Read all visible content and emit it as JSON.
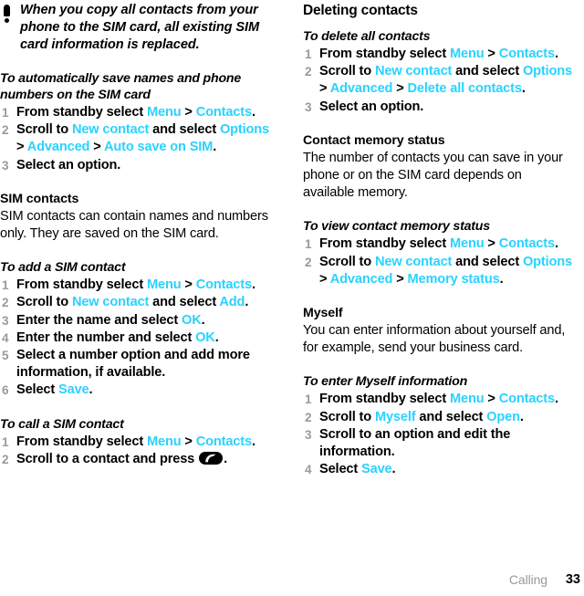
{
  "accent_color": "#2ad2ff",
  "muted_color": "#9a9a9a",
  "note": {
    "icon": "exclamation-note-icon",
    "text": "When you copy all contacts from your phone to the SIM card, all existing SIM card information is replaced."
  },
  "left_column": {
    "proc_autosave": {
      "heading": "To automatically save names and phone numbers on the SIM card",
      "steps": [
        {
          "num": "1",
          "parts": [
            {
              "t": "From standby select ",
              "k": "plain"
            },
            {
              "t": "Menu",
              "k": "ui"
            },
            {
              "t": " > ",
              "k": "sep"
            },
            {
              "t": "Contacts",
              "k": "ui"
            },
            {
              "t": ".",
              "k": "plain"
            }
          ]
        },
        {
          "num": "2",
          "parts": [
            {
              "t": "Scroll to ",
              "k": "plain"
            },
            {
              "t": "New contact",
              "k": "ui"
            },
            {
              "t": " and select ",
              "k": "plain"
            },
            {
              "t": "Options",
              "k": "ui"
            },
            {
              "t": " > ",
              "k": "sep"
            },
            {
              "t": "Advanced",
              "k": "ui"
            },
            {
              "t": " > ",
              "k": "sep"
            },
            {
              "t": "Auto save on SIM",
              "k": "ui"
            },
            {
              "t": ".",
              "k": "plain"
            }
          ]
        },
        {
          "num": "3",
          "parts": [
            {
              "t": "Select an option.",
              "k": "plain"
            }
          ]
        }
      ]
    },
    "sim_contacts": {
      "heading": "SIM contacts",
      "body": "SIM contacts can contain names and numbers only. They are saved on the SIM card."
    },
    "proc_add_sim": {
      "heading": "To add a SIM contact",
      "steps": [
        {
          "num": "1",
          "parts": [
            {
              "t": "From standby select ",
              "k": "plain"
            },
            {
              "t": "Menu",
              "k": "ui"
            },
            {
              "t": " > ",
              "k": "sep"
            },
            {
              "t": "Contacts",
              "k": "ui"
            },
            {
              "t": ".",
              "k": "plain"
            }
          ]
        },
        {
          "num": "2",
          "parts": [
            {
              "t": "Scroll to ",
              "k": "plain"
            },
            {
              "t": "New contact",
              "k": "ui"
            },
            {
              "t": " and select ",
              "k": "plain"
            },
            {
              "t": "Add",
              "k": "ui"
            },
            {
              "t": ".",
              "k": "plain"
            }
          ]
        },
        {
          "num": "3",
          "parts": [
            {
              "t": "Enter the name and select ",
              "k": "plain"
            },
            {
              "t": "OK",
              "k": "ui"
            },
            {
              "t": ".",
              "k": "plain"
            }
          ]
        },
        {
          "num": "4",
          "parts": [
            {
              "t": "Enter the number and select ",
              "k": "plain"
            },
            {
              "t": "OK",
              "k": "ui"
            },
            {
              "t": ".",
              "k": "plain"
            }
          ]
        },
        {
          "num": "5",
          "parts": [
            {
              "t": "Select a number option and add more information, if available.",
              "k": "plain"
            }
          ]
        },
        {
          "num": "6",
          "parts": [
            {
              "t": "Select ",
              "k": "plain"
            },
            {
              "t": "Save",
              "k": "ui"
            },
            {
              "t": ".",
              "k": "plain"
            }
          ]
        }
      ]
    },
    "proc_call_sim": {
      "heading": "To call a SIM contact",
      "steps": [
        {
          "num": "1",
          "parts": [
            {
              "t": "From standby select ",
              "k": "plain"
            },
            {
              "t": "Menu",
              "k": "ui"
            },
            {
              "t": " > ",
              "k": "sep"
            },
            {
              "t": "Contacts",
              "k": "ui"
            },
            {
              "t": ".",
              "k": "plain"
            }
          ]
        },
        {
          "num": "2",
          "parts": [
            {
              "t": "Scroll to a contact and press ",
              "k": "plain"
            },
            {
              "t": "",
              "k": "call-key-icon"
            },
            {
              "t": ".",
              "k": "plain"
            }
          ]
        }
      ]
    }
  },
  "right_column": {
    "section_heading": "Deleting contacts",
    "proc_delete_all": {
      "heading": "To delete all contacts",
      "steps": [
        {
          "num": "1",
          "parts": [
            {
              "t": "From standby select ",
              "k": "plain"
            },
            {
              "t": "Menu",
              "k": "ui"
            },
            {
              "t": " > ",
              "k": "sep"
            },
            {
              "t": "Contacts",
              "k": "ui"
            },
            {
              "t": ".",
              "k": "plain"
            }
          ]
        },
        {
          "num": "2",
          "parts": [
            {
              "t": "Scroll to ",
              "k": "plain"
            },
            {
              "t": "New contact",
              "k": "ui"
            },
            {
              "t": " and select ",
              "k": "plain"
            },
            {
              "t": "Options",
              "k": "ui"
            },
            {
              "t": " > ",
              "k": "sep"
            },
            {
              "t": "Advanced",
              "k": "ui"
            },
            {
              "t": " > ",
              "k": "sep"
            },
            {
              "t": "Delete all contacts",
              "k": "ui"
            },
            {
              "t": ".",
              "k": "plain"
            }
          ]
        },
        {
          "num": "3",
          "parts": [
            {
              "t": "Select an option.",
              "k": "plain"
            }
          ]
        }
      ]
    },
    "memory_status": {
      "heading": "Contact memory status",
      "body": "The number of contacts you can save in your phone or on the SIM card depends on available memory."
    },
    "proc_view_memory": {
      "heading": "To view contact memory status",
      "steps": [
        {
          "num": "1",
          "parts": [
            {
              "t": "From standby select ",
              "k": "plain"
            },
            {
              "t": "Menu",
              "k": "ui"
            },
            {
              "t": " > ",
              "k": "sep"
            },
            {
              "t": "Contacts",
              "k": "ui"
            },
            {
              "t": ".",
              "k": "plain"
            }
          ]
        },
        {
          "num": "2",
          "parts": [
            {
              "t": "Scroll to ",
              "k": "plain"
            },
            {
              "t": "New contact",
              "k": "ui"
            },
            {
              "t": " and select ",
              "k": "plain"
            },
            {
              "t": "Options",
              "k": "ui"
            },
            {
              "t": " > ",
              "k": "sep"
            },
            {
              "t": "Advanced",
              "k": "ui"
            },
            {
              "t": " > ",
              "k": "sep"
            },
            {
              "t": "Memory status",
              "k": "ui"
            },
            {
              "t": ".",
              "k": "plain"
            }
          ]
        }
      ]
    },
    "myself": {
      "heading": "Myself",
      "body": "You can enter information about yourself and, for example, send your business card."
    },
    "proc_myself": {
      "heading": "To enter Myself information",
      "steps": [
        {
          "num": "1",
          "parts": [
            {
              "t": "From standby select ",
              "k": "plain"
            },
            {
              "t": "Menu",
              "k": "ui"
            },
            {
              "t": " > ",
              "k": "sep"
            },
            {
              "t": "Contacts",
              "k": "ui"
            },
            {
              "t": ".",
              "k": "plain"
            }
          ]
        },
        {
          "num": "2",
          "parts": [
            {
              "t": "Scroll to ",
              "k": "plain"
            },
            {
              "t": "Myself",
              "k": "ui"
            },
            {
              "t": " and select ",
              "k": "plain"
            },
            {
              "t": "Open",
              "k": "ui"
            },
            {
              "t": ".",
              "k": "plain"
            }
          ]
        },
        {
          "num": "3",
          "parts": [
            {
              "t": "Scroll to an option and edit the information.",
              "k": "plain"
            }
          ]
        },
        {
          "num": "4",
          "parts": [
            {
              "t": "Select ",
              "k": "plain"
            },
            {
              "t": "Save",
              "k": "ui"
            },
            {
              "t": ".",
              "k": "plain"
            }
          ]
        }
      ]
    }
  },
  "footer": {
    "chapter": "Calling",
    "page": "33"
  }
}
